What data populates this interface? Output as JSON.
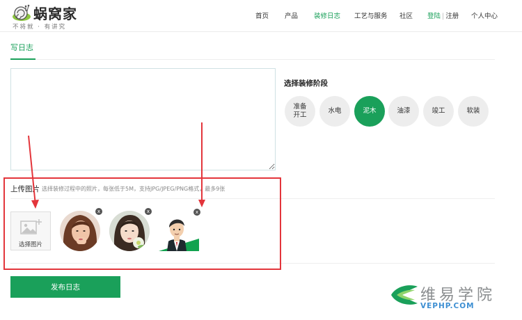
{
  "header": {
    "brand": "蜗窝家",
    "slogan": "不将就 · 有讲究",
    "nav": [
      {
        "label": "首页"
      },
      {
        "label": "产品"
      },
      {
        "label": "装修日志"
      },
      {
        "label": "工艺与服务"
      },
      {
        "label": "社区"
      }
    ],
    "login": "登陆",
    "separator": "|",
    "register": "注册",
    "user_center": "个人中心",
    "active_nav": "装修日志"
  },
  "tab": {
    "label": "写日志"
  },
  "editor": {
    "value": ""
  },
  "stages": {
    "title": "选择装修阶段",
    "items": [
      {
        "line1": "准备",
        "line2": "开工"
      },
      {
        "line1": "水电",
        "line2": ""
      },
      {
        "line1": "泥木",
        "line2": ""
      },
      {
        "line1": "油漆",
        "line2": ""
      },
      {
        "line1": "竣工",
        "line2": ""
      },
      {
        "line1": "软装",
        "line2": ""
      }
    ],
    "selected": "泥木"
  },
  "upload": {
    "title": "上传图片",
    "hint": "选择装修过程中的照片，每张低于5M，支持JPG/JPEG/PNG格式，最多9张",
    "add_label": "选择图片",
    "remove_symbol": "x"
  },
  "publish": {
    "label": "发布日志"
  },
  "watermark": {
    "title": "维易学院",
    "site": "VEPHP.COM"
  },
  "colors": {
    "accent": "#1aa05a",
    "annotation": "#e3353b",
    "watermark_blue": "#3e8fd2"
  }
}
